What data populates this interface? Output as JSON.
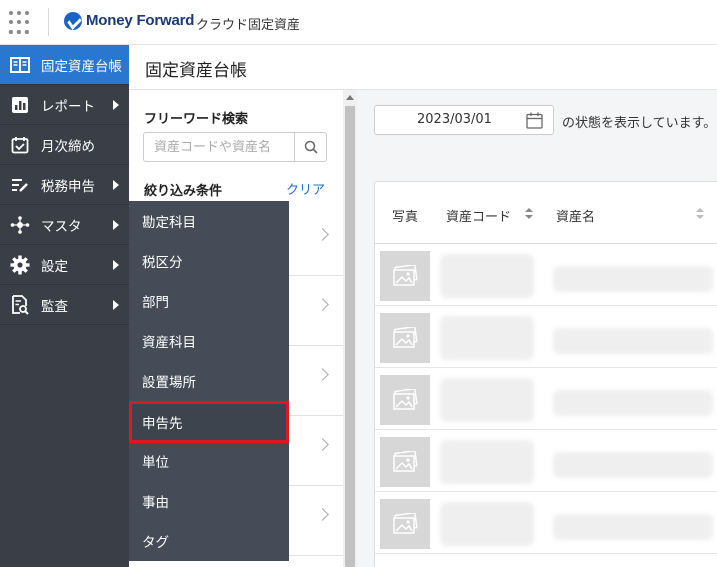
{
  "header": {
    "brand": "Money Forward",
    "product": "クラウド固定資産"
  },
  "sidebar": {
    "items": [
      {
        "label": "固定資産台帳",
        "icon": "ledger-icon",
        "active": true,
        "submenu": false
      },
      {
        "label": "レポート",
        "icon": "report-icon",
        "active": false,
        "submenu": true
      },
      {
        "label": "月次締め",
        "icon": "monthly-close-icon",
        "active": false,
        "submenu": false
      },
      {
        "label": "税務申告",
        "icon": "tax-filing-icon",
        "active": false,
        "submenu": true
      },
      {
        "label": "マスタ",
        "icon": "master-icon",
        "active": false,
        "submenu": true
      },
      {
        "label": "設定",
        "icon": "gear-icon",
        "active": false,
        "submenu": true
      },
      {
        "label": "監査",
        "icon": "audit-icon",
        "active": false,
        "submenu": true
      }
    ]
  },
  "submenu": {
    "items": [
      {
        "label": "勘定科目"
      },
      {
        "label": "税区分"
      },
      {
        "label": "部門"
      },
      {
        "label": "資産科目"
      },
      {
        "label": "設置場所"
      },
      {
        "label": "申告先",
        "highlighted": true
      },
      {
        "label": "単位"
      },
      {
        "label": "事由"
      },
      {
        "label": "タグ"
      }
    ]
  },
  "page": {
    "title": "固定資産台帳"
  },
  "filter": {
    "freeword_title": "フリーワード検索",
    "search_placeholder": "資産コードや資産名",
    "narrow_title": "絞り込み条件",
    "clear_label": "クリア"
  },
  "main": {
    "date_value": "2023/03/01",
    "status_text": "の状態を表示しています。",
    "table": {
      "columns": [
        "写真",
        "資産コード",
        "資産名"
      ]
    }
  },
  "colors": {
    "sidebar_bg": "#3a3f47",
    "active": "#2a77d0",
    "submenu_bg": "#454c57",
    "highlight_border": "#e3151e",
    "link": "#1a6fd1"
  }
}
